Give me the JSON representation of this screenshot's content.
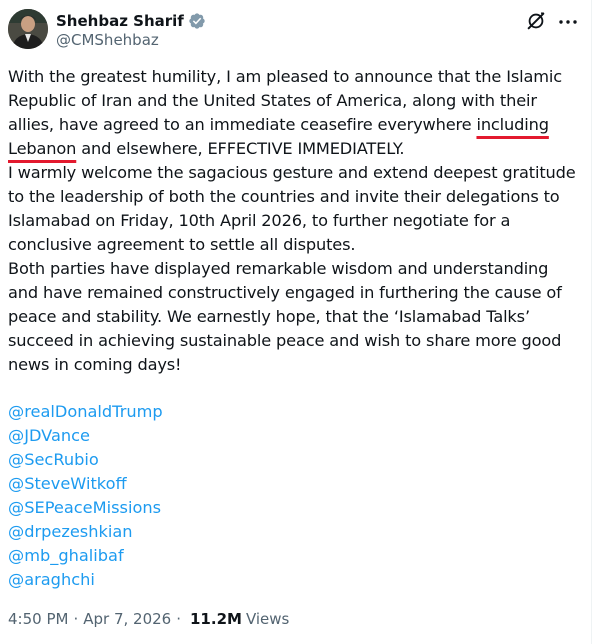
{
  "author": {
    "display_name": "Shehbaz Sharif",
    "handle": "@CMShehbaz",
    "verified": true
  },
  "icons": {
    "avatar": "avatar-photo",
    "verified": "verified-badge-icon",
    "grok": "grok-icon",
    "more": "more-options-icon"
  },
  "post": {
    "p1_before": "With the greatest humility, I am pleased to announce that the Islamic Republic of Iran and the United States of America, along with their allies, have agreed to an immediate ceasefire everywhere ",
    "p1_highlight": "including Lebanon",
    "p1_after": " and elsewhere, EFFECTIVE IMMEDIATELY.",
    "p2": "I warmly welcome the sagacious gesture and extend deepest gratitude to the leadership of both the countries and invite their delegations to Islamabad on Friday, 10th April 2026, to further negotiate for a conclusive agreement to settle all disputes.",
    "p3": "Both parties have displayed remarkable wisdom and understanding and have remained constructively engaged in furthering the cause of peace and stability. We earnestly hope, that the ‘Islamabad Talks’ succeed in achieving sustainable peace and wish to share more good news in coming days!",
    "mentions": [
      "@realDonaldTrump",
      "@JDVance",
      "@SecRubio",
      "@SteveWitkoff",
      "@SEPeaceMissions",
      "@drpezeshkian",
      "@mb_ghalibaf",
      "@araghchi"
    ]
  },
  "meta": {
    "time": "4:50 PM",
    "separator": "·",
    "date": "Apr 7, 2026",
    "views_count": "11.2M",
    "views_label": "Views"
  },
  "colors": {
    "link": "#1d9bf0",
    "secondary": "#536471",
    "highlight_underline": "#e3192e",
    "verified": "#829aab"
  }
}
